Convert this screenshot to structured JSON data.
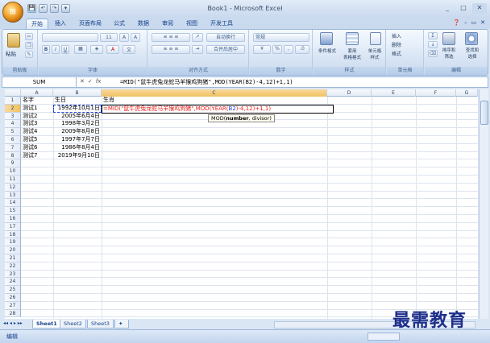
{
  "window": {
    "title": "Book1 - Microsoft Excel",
    "office_button": "⊞"
  },
  "qat": [
    "💾",
    "↶",
    "↷",
    "▾"
  ],
  "window_controls": [
    "_",
    "□",
    "✕"
  ],
  "tabs": [
    "开始",
    "插入",
    "页面布局",
    "公式",
    "数据",
    "审阅",
    "视图",
    "开发工具"
  ],
  "active_tab": "开始",
  "ribbon": {
    "groups": [
      "剪贴板",
      "字体",
      "对齐方式",
      "数字",
      "样式",
      "单元格",
      "编辑"
    ],
    "paste_label": "粘贴",
    "font_size": "11",
    "wrap_text": "自动换行",
    "merge_center": "合并后居中",
    "number_format": "常规",
    "conditional_format": "条件格式",
    "table_format": "套用\n表格格式",
    "cell_style": "单元格\n样式",
    "insert": "插入",
    "delete": "删除",
    "format": "格式",
    "sort_filter": "排序和\n筛选",
    "find_select": "查找和\n选择"
  },
  "formula_bar": {
    "name_box": "SUM",
    "cancel": "✕",
    "enter": "✓",
    "fx": "fx",
    "formula": "=MID(\"鼠牛虎兔龙蛇马羊猴鸡狗猪\",MOD(YEAR(B2)-4,12)+1,1)"
  },
  "columns": [
    "A",
    "B",
    "C",
    "D",
    "E",
    "F",
    "G",
    "H"
  ],
  "rows": [
    "1",
    "2",
    "3",
    "4",
    "5",
    "6",
    "7",
    "8",
    "9",
    "10",
    "11",
    "12",
    "13",
    "14",
    "15",
    "16",
    "17",
    "18",
    "19",
    "20",
    "21",
    "22",
    "23",
    "24",
    "25",
    "26",
    "27",
    "28"
  ],
  "cells": {
    "A1": "名字",
    "B1": "生日",
    "C1": "生肖",
    "A2": "测试1",
    "B2": "1992年10月1日",
    "A3": "测试2",
    "B3": "2005年6月4日",
    "A4": "测试3",
    "B4": "1998年3月2日",
    "A5": "测试4",
    "B5": "2009年8月8日",
    "A6": "测试5",
    "B6": "1997年7月7日",
    "A7": "测试6",
    "B7": "1986年8月4日",
    "A8": "测试7",
    "B8": "2019年9月10日"
  },
  "edit_cell": {
    "address": "C2",
    "text_before": "=MID(\"鼠牛虎兔龙蛇马羊猴鸡狗猪\",MOD(YEAR(",
    "ref": "B2",
    "text_after": ")-4,12)+1,1)"
  },
  "tooltip": {
    "func": "MOD(",
    "arg1": "number",
    "sep": ", ",
    "arg2": "divisor",
    "close": ")"
  },
  "sheet_tabs": [
    "Sheet1",
    "Sheet2",
    "Sheet3"
  ],
  "active_sheet": "Sheet1",
  "status": {
    "mode": "编辑"
  },
  "watermark": "最需教育",
  "colors": {
    "accent": "#15428b",
    "edit_text": "#e8201c",
    "ref_text": "#1f3fd6"
  }
}
